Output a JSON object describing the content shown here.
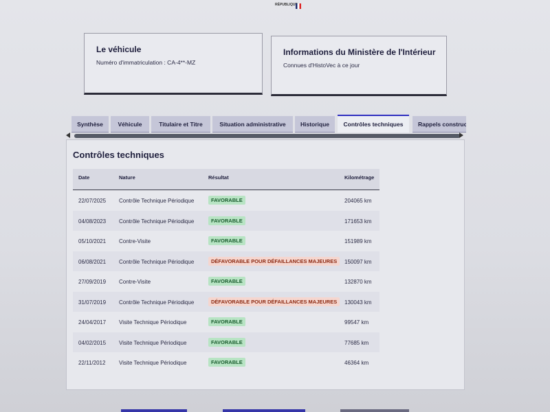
{
  "logo": {
    "text": "RÉPUBLIQUE"
  },
  "vehicle_card": {
    "title": "Le véhicule",
    "plate_label": "Numéro d'immatriculation : CA-4**-MZ"
  },
  "ministry_card": {
    "title": "Informations du Ministère de l'Intérieur",
    "subtitle": "Connues d'HistoVec à ce jour"
  },
  "tabs": [
    {
      "label": "Synthèse"
    },
    {
      "label": "Véhicule"
    },
    {
      "label": "Titulaire et Titre"
    },
    {
      "label": "Situation administrative"
    },
    {
      "label": "Historique"
    },
    {
      "label": "Contrôles techniques"
    },
    {
      "label": "Rappels constructeur"
    }
  ],
  "active_tab": "Contrôles techniques",
  "section": {
    "title": "Contrôles techniques",
    "columns": [
      "Date",
      "Nature",
      "Résultat",
      "Kilométrage"
    ],
    "rows": [
      {
        "date": "22/07/2025",
        "nature": "Contrôle Technique Périodique",
        "result": "FAVORABLE",
        "km": "204065 km"
      },
      {
        "date": "04/08/2023",
        "nature": "Contrôle Technique Périodique",
        "result": "FAVORABLE",
        "km": "171653 km"
      },
      {
        "date": "05/10/2021",
        "nature": "Contre-Visite",
        "result": "FAVORABLE",
        "km": "151989 km"
      },
      {
        "date": "06/08/2021",
        "nature": "Contrôle Technique Périodique",
        "result": "DÉFAVORABLE POUR DÉFAILLANCES MAJEURES",
        "km": "150097 km"
      },
      {
        "date": "27/09/2019",
        "nature": "Contre-Visite",
        "result": "FAVORABLE",
        "km": "132870 km"
      },
      {
        "date": "31/07/2019",
        "nature": "Contrôle Technique Périodique",
        "result": "DÉFAVORABLE POUR DÉFAILLANCES MAJEURES",
        "km": "130043 km"
      },
      {
        "date": "24/04/2017",
        "nature": "Visite Technique Périodique",
        "result": "FAVORABLE",
        "km": "99547 km"
      },
      {
        "date": "04/02/2015",
        "nature": "Visite Technique Périodique",
        "result": "FAVORABLE",
        "km": "77685 km"
      },
      {
        "date": "22/11/2012",
        "nature": "Visite Technique Périodique",
        "result": "FAVORABLE",
        "km": "46364 km"
      }
    ]
  },
  "colors": {
    "accent": "#2d2dbf",
    "favorable_bg": "#b8e4c4",
    "defavorable_bg": "#f5d6cf"
  }
}
